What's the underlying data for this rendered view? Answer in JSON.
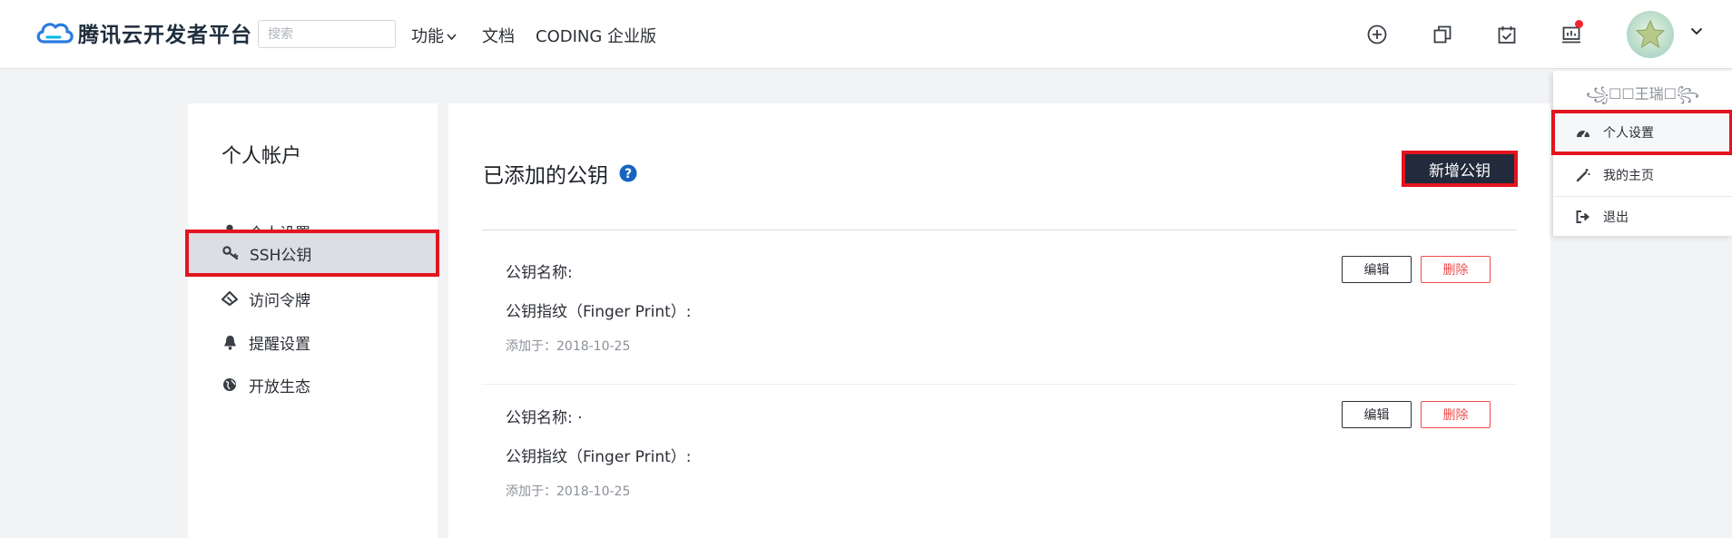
{
  "header": {
    "brand": "腾讯云开发者平台",
    "search_placeholder": "搜索",
    "nav": {
      "features": "功能",
      "docs": "文档",
      "coding": "CODING 企业版"
    },
    "icons": [
      "plus-circle-icon",
      "copy-icon",
      "calendar-check-icon",
      "presentation-icon"
    ],
    "notification_dot_color": "#f5222d"
  },
  "sidebar": {
    "title": "个人帐户",
    "items": [
      {
        "label": "个人设置",
        "icon": "user-icon"
      },
      {
        "label": "SSH公钥",
        "icon": "key-icon",
        "active": true
      },
      {
        "label": "访问令牌",
        "icon": "ticket-icon"
      },
      {
        "label": "提醒设置",
        "icon": "bell-icon"
      },
      {
        "label": "开放生态",
        "icon": "globe-icon"
      }
    ]
  },
  "main": {
    "title": "已添加的公钥",
    "add_button": "新增公钥",
    "keys": [
      {
        "name_label": "公钥名称:",
        "fingerprint_label": "公钥指纹（Finger Print）:",
        "added": "添加于：2018-10-25",
        "edit": "编辑",
        "delete": "删除"
      },
      {
        "name_label": "公钥名称: ·",
        "fingerprint_label": "公钥指纹（Finger Print）:",
        "added": "添加于：2018-10-25",
        "edit": "编辑",
        "delete": "删除"
      }
    ]
  },
  "dropdown": {
    "username": "꧁☐☐王瑞☐꧂",
    "items": [
      {
        "label": "个人设置",
        "icon": "dashboard-icon",
        "active": true
      },
      {
        "label": "我的主页",
        "icon": "magic-wand-icon"
      },
      {
        "label": "退出",
        "icon": "sign-out-icon"
      }
    ]
  },
  "colors": {
    "accent_dark": "#222b3b",
    "highlight_red": "#e3141f",
    "help_blue": "#1565c0",
    "delete_red": "#f04b4b"
  }
}
